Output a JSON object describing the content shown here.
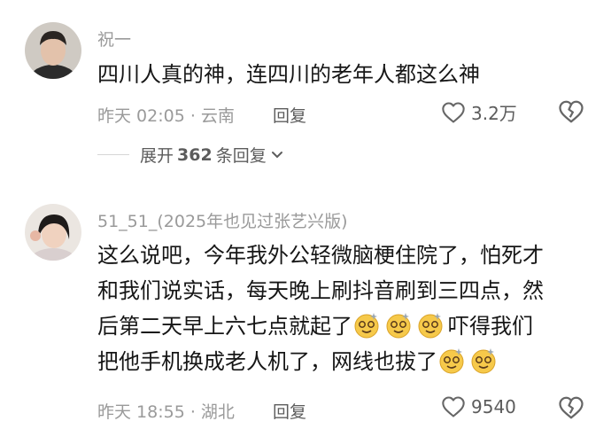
{
  "comments": [
    {
      "username": "祝一",
      "lines": [
        "四川人真的神，连四川的老年人都这么神"
      ],
      "time": "昨天 02:05",
      "location": "云南",
      "reply_label": "回复",
      "likes": "3.2万",
      "expand": {
        "prefix": "展开",
        "count": "362",
        "suffix": "条回复"
      }
    },
    {
      "username": "51_51_(2025年也见过张艺兴版)",
      "lines": [
        "这么说吧，今年我外公轻微脑梗住院了，怕死才",
        "和我们说实话，每天晚上刷抖音刷到三四点，然",
        "后第二天早上六七点就起了",
        "吓得我们",
        "把他手机换成老人机了，网线也拔了"
      ],
      "time": "昨天 18:55",
      "location": "湖北",
      "reply_label": "回复",
      "likes": "9540"
    }
  ],
  "icons": {
    "like": "heart-outline-icon",
    "dislike": "broken-heart-icon",
    "expand": "chevron-down-icon",
    "emoji": "dizzy-face-emoji"
  },
  "colors": {
    "primary_text": "#161616",
    "secondary_text": "#9a9a9a",
    "action_text": "#5c5c5c"
  }
}
